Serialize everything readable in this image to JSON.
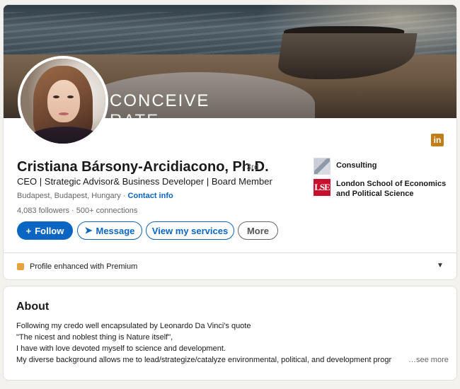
{
  "profile": {
    "banner_text_line1": "CONCEIVE",
    "banner_text_line2": "RATE",
    "name": "Cristiana Bársony-Arcidiacono, Ph.D.",
    "degree": "· 3rd",
    "headline": "CEO | Strategic Advisor& Business Developer | Board Member",
    "location": "Budapest, Budapest, Hungary",
    "location_sep": " · ",
    "contact_info": "Contact info",
    "followers": "4,083 followers",
    "connections_sep": " · ",
    "connections": "500+ connections",
    "linkedin_badge": "in"
  },
  "actions": {
    "follow_glyph": "+",
    "follow": "Follow",
    "message_glyph": "➤",
    "message": "Message",
    "services": "View my services",
    "more": "More"
  },
  "experience": [
    {
      "label": "Consulting"
    },
    {
      "label": "London School of Economics and Political Science",
      "logo_text": "LSE"
    }
  ],
  "premium": {
    "label": "Profile enhanced with Premium",
    "caret": "▼"
  },
  "about": {
    "title": "About",
    "lines": [
      "Following my credo well encapsulated by Leonardo Da Vinci's quote",
      "\"The nicest and noblest thing is Nature itself\",",
      "I have with love devoted myself to science and development.",
      "My diverse background allows me to lead/strategize/catalyze environmental, political, and development progr"
    ],
    "see_more": "…see more"
  },
  "colors": {
    "primary": "#0a66c2",
    "lse_red": "#c8102e",
    "premium_gold": "#e7a33e",
    "linkedin_badge": "#c37d16"
  }
}
